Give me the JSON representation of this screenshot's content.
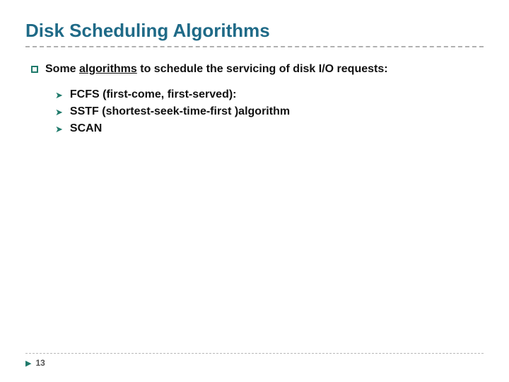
{
  "title": "Disk Scheduling Algorithms",
  "lead": {
    "prefix": "Some ",
    "underlined": "algorithms",
    "suffix": " to schedule the servicing of disk I/O requests:"
  },
  "items": [
    "FCFS (first-come, first-served):",
    "SSTF (shortest-seek-time-first )algorithm",
    "SCAN"
  ],
  "page_number": "13"
}
